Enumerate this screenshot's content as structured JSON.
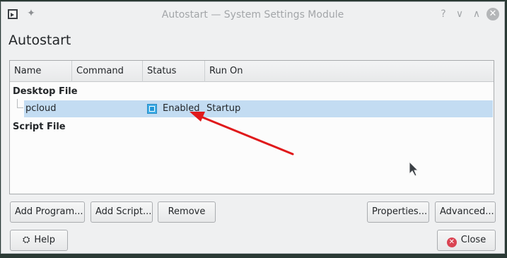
{
  "window": {
    "title": "Autostart — System Settings Module",
    "help_glyph": "?",
    "minimize_glyph": "∨",
    "maximize_glyph": "∧",
    "close_glyph": "✕"
  },
  "page": {
    "heading": "Autostart"
  },
  "table": {
    "columns": [
      "Name",
      "Command",
      "Status",
      "Run On"
    ],
    "groups": [
      {
        "label": "Desktop File",
        "rows": [
          {
            "name": "pcloud",
            "command": "",
            "status": "Enabled",
            "status_checked": true,
            "run_on": "Startup",
            "selected": true
          }
        ]
      },
      {
        "label": "Script File",
        "rows": []
      }
    ]
  },
  "buttons": {
    "add_program": "Add Program...",
    "add_script": "Add Script...",
    "remove": "Remove",
    "properties": "Properties...",
    "advanced": "Advanced...",
    "help": "Help",
    "close": "Close"
  },
  "icons": {
    "app": "settings-window-icon",
    "pin": "pin-icon",
    "help": "lifebuoy-icon",
    "close": "close-circle-icon"
  },
  "colors": {
    "selection": "#c3dcf2",
    "checkbox": "#3daee9",
    "arrow": "#e0191b",
    "close_icon": "#da4453"
  }
}
